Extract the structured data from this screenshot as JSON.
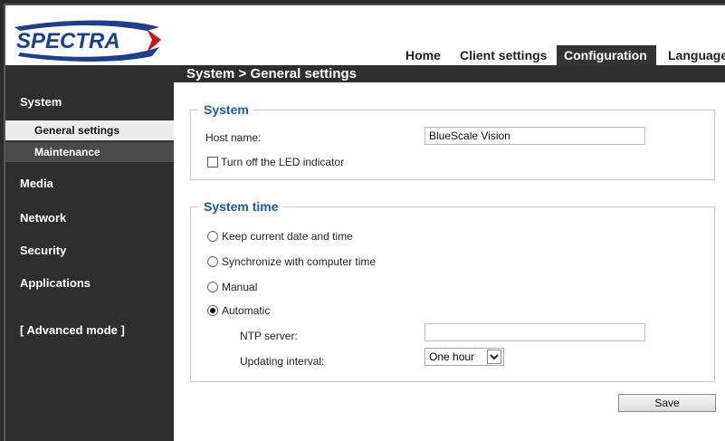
{
  "brand": {
    "logo_text": "SPECTRA"
  },
  "nav": {
    "tabs": [
      {
        "label": "Home"
      },
      {
        "label": "Client settings"
      },
      {
        "label": "Configuration",
        "active": true
      },
      {
        "label": "Language"
      }
    ]
  },
  "breadcrumb": "System  > General settings",
  "sidebar": {
    "items": [
      {
        "label": "System"
      },
      {
        "label": "General settings",
        "active": true
      },
      {
        "label": "Maintenance"
      },
      {
        "label": "Media"
      },
      {
        "label": "Network"
      },
      {
        "label": "Security"
      },
      {
        "label": "Applications"
      },
      {
        "label": "[ Advanced mode ]"
      }
    ]
  },
  "system": {
    "legend": "System",
    "host_name_label": "Host name:",
    "host_name_value": "BlueScale Vision",
    "led_label": "Turn off the LED indicator",
    "led_checked": false
  },
  "system_time": {
    "legend": "System time",
    "options": [
      {
        "label": "Keep current date and time",
        "selected": false
      },
      {
        "label": "Synchronize with computer time",
        "selected": false
      },
      {
        "label": "Manual",
        "selected": false
      },
      {
        "label": "Automatic",
        "selected": true
      }
    ],
    "ntp_label": "NTP server:",
    "ntp_value": "",
    "interval_label": "Updating interval:",
    "interval_value": "One hour"
  },
  "actions": {
    "save_label": "Save"
  },
  "colors": {
    "dark": "#2e2e2e",
    "legend_blue": "#1a5aa8",
    "logo_red": "#c8161d",
    "logo_blue": "#1c3f94"
  }
}
